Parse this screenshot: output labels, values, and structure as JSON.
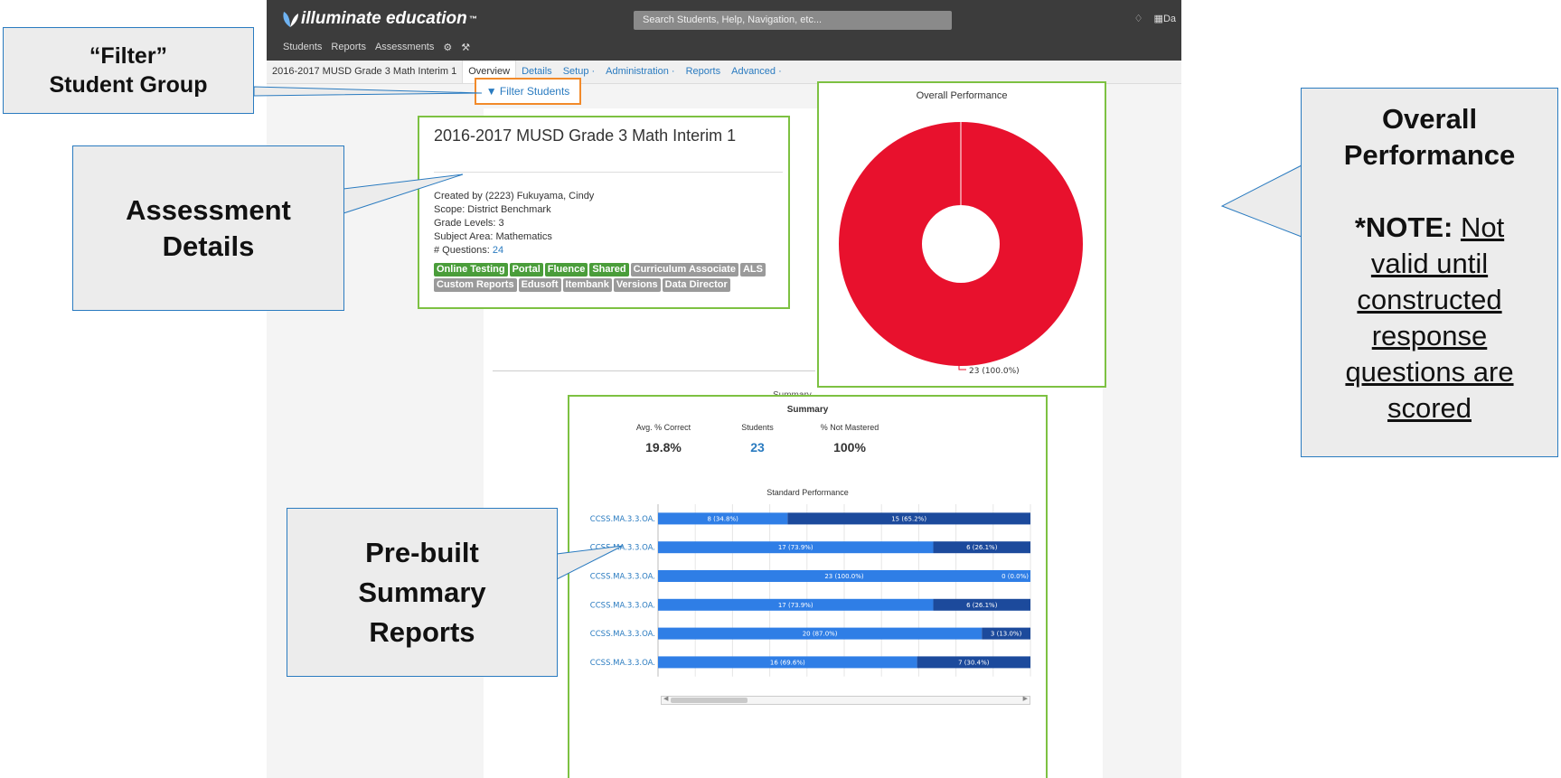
{
  "app": {
    "logo_text": "illuminate education",
    "logo_tm": "™",
    "search_placeholder": "Search Students, Help, Navigation, etc...",
    "top_icons": [
      "bell-icon",
      "grid-icon"
    ],
    "top_right_text": "Da",
    "main_nav": [
      "Students",
      "Reports",
      "Assessments"
    ],
    "tabs": [
      "2016-2017 MUSD Grade 3 Math Interim 1",
      "Overview",
      "Details",
      "Setup ·",
      "Administration ·",
      "Reports",
      "Advanced ·"
    ],
    "filter_button": "Filter Students"
  },
  "details": {
    "title": "2016-2017 MUSD Grade 3 Math Interim 1",
    "created_by": "Created by (2223) Fukuyama, Cindy",
    "scope": "Scope: District Benchmark",
    "grade_levels": "Grade Levels: 3",
    "subject_area": "Subject Area: Mathematics",
    "questions_label": "# Questions: ",
    "questions_value": "24",
    "tags": [
      {
        "text": "Online Testing",
        "color": "green"
      },
      {
        "text": "Portal",
        "color": "green"
      },
      {
        "text": "Fluence",
        "color": "green"
      },
      {
        "text": "Shared",
        "color": "green"
      },
      {
        "text": "Curriculum Associate",
        "color": "gray"
      },
      {
        "text": "ALS",
        "color": "gray"
      },
      {
        "text": "Custom Reports",
        "color": "gray"
      },
      {
        "text": "Edusoft",
        "color": "gray"
      },
      {
        "text": "Itembank",
        "color": "gray"
      },
      {
        "text": "Versions",
        "color": "gray"
      },
      {
        "text": "Data Director",
        "color": "gray"
      }
    ]
  },
  "summary": {
    "ghost_title": "Summary",
    "title": "Summary",
    "avg_label": "Avg. % Correct",
    "avg_value": "19.8%",
    "students_label": "Students",
    "students_value": "23",
    "not_mastered_label": "% Not Mastered",
    "not_mastered_value": "100%"
  },
  "chart_data": [
    {
      "type": "pie",
      "title": "Overall Performance",
      "donut": true,
      "slices": [
        {
          "value": 23,
          "label": "23 (100.0%)",
          "color": "#e8112d"
        }
      ]
    },
    {
      "type": "bar",
      "orientation": "horizontal",
      "stacked": true,
      "title": "Standard Performance",
      "categories": [
        "CCSS.MA.3.3.OA.",
        "CCSS.MA.3.3.OA.",
        "CCSS.MA.3.3.OA.",
        "CCSS.MA.3.3.OA.",
        "CCSS.MA.3.3.OA.",
        "CCSS.MA.3.3.OA."
      ],
      "series": [
        {
          "values": [
            8,
            17,
            23,
            17,
            20,
            16
          ],
          "labels": [
            "8 (34.8%)",
            "17 (73.9%)",
            "23 (100.0%)",
            "17 (73.9%)",
            "20 (87.0%)",
            "16 (69.6%)"
          ],
          "color": "#2f7ee6"
        },
        {
          "values": [
            15,
            6,
            0,
            6,
            3,
            7
          ],
          "labels": [
            "15 (65.2%)",
            "6 (26.1%)",
            "0 (0.0%)",
            "6 (26.1%)",
            "3 (13.0%)",
            "7 (30.4%)"
          ],
          "color": "#1c4a9c"
        }
      ],
      "xlim": [
        0,
        23
      ]
    }
  ],
  "callouts": {
    "filter": {
      "lines": [
        "“Filter”",
        "Student Group"
      ]
    },
    "assessment": {
      "lines": [
        "Assessment",
        "Details"
      ]
    },
    "summary": {
      "lines": [
        "Pre-built",
        "Summary",
        "Reports"
      ]
    },
    "overall": {
      "title_lines": [
        "Overall",
        "Performance"
      ],
      "note_prefix": "*NOTE:",
      "note_lines": [
        "Not",
        "valid until",
        "constructed",
        "response",
        "questions are",
        "scored"
      ]
    }
  }
}
